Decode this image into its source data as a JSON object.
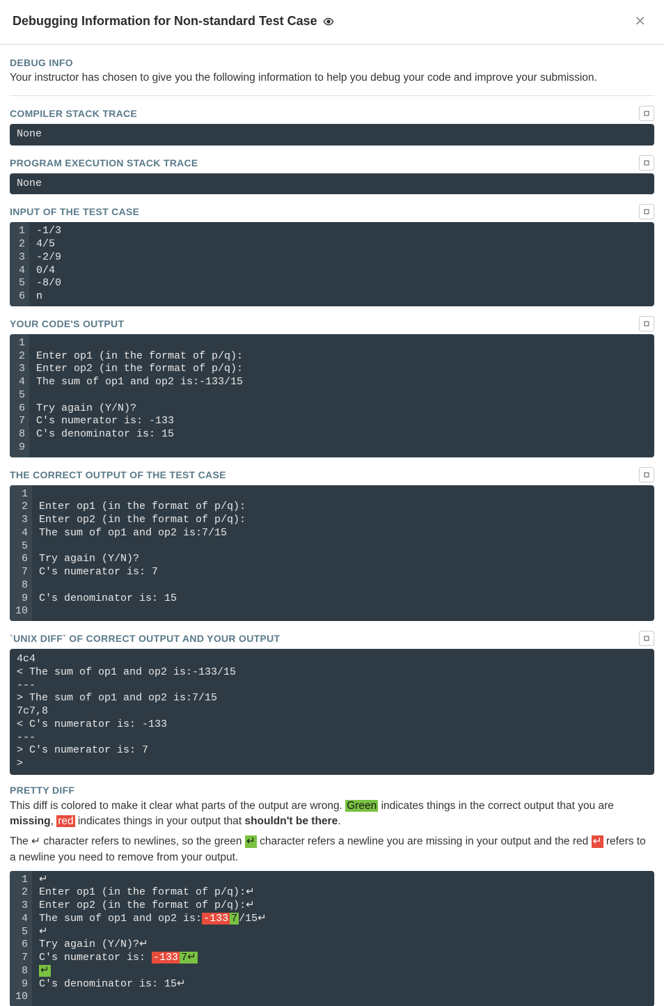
{
  "header": {
    "title": "Debugging Information for Non-standard Test Case"
  },
  "debugInfo": {
    "label": "DEBUG INFO",
    "desc": "Your instructor has chosen to give you the following information to help you debug your code and improve your submission."
  },
  "compilerTrace": {
    "label": "COMPILER STACK TRACE",
    "content": "None"
  },
  "execTrace": {
    "label": "PROGRAM EXECUTION STACK TRACE",
    "content": "None"
  },
  "inputCase": {
    "label": "INPUT OF THE TEST CASE",
    "lines": [
      "-1/3",
      "4/5",
      "-2/9",
      "0/4",
      "-8/0",
      "n"
    ]
  },
  "yourOutput": {
    "label": "YOUR CODE'S OUTPUT",
    "lines": [
      "",
      "Enter op1 (in the format of p/q):",
      "Enter op2 (in the format of p/q):",
      "The sum of op1 and op2 is:-133/15",
      "",
      "Try again (Y/N)?",
      "C's numerator is: -133",
      "C's denominator is: 15",
      ""
    ]
  },
  "correctOutput": {
    "label": "THE CORRECT OUTPUT OF THE TEST CASE",
    "lines": [
      "",
      "Enter op1 (in the format of p/q):",
      "Enter op2 (in the format of p/q):",
      "The sum of op1 and op2 is:7/15",
      "",
      "Try again (Y/N)?",
      "C's numerator is: 7",
      "",
      "C's denominator is: 15",
      ""
    ]
  },
  "unixDiff": {
    "label": "`UNIX DIFF` OF CORRECT OUTPUT AND YOUR OUTPUT",
    "content": "4c4\n< The sum of op1 and op2 is:-133/15\n---\n> The sum of op1 and op2 is:7/15\n7c7,8\n< C's numerator is: -133\n---\n> C's numerator is: 7\n>"
  },
  "prettyDiff": {
    "label": "PRETTY DIFF",
    "desc1_a": "This diff is colored to make it clear what parts of the output are wrong. ",
    "desc1_green": "Green",
    "desc1_b": " indicates things in the correct output that you are ",
    "desc1_missing": "missing",
    "desc1_c": ", ",
    "desc1_red": "red",
    "desc1_d": " indicates things in your output that ",
    "desc1_shouldnt": "shouldn't be there",
    "desc1_e": ".",
    "desc2_a": "The ",
    "desc2_nl1": "↵",
    "desc2_b": " character refers to newlines, so the green ",
    "desc2_nl2": "↵",
    "desc2_c": " character refers a newline you are missing in your output and the red ",
    "desc2_nl3": "↵",
    "desc2_d": " refers to a newline you need to remove from your output.",
    "lines": [
      [
        {
          "t": "↵",
          "c": ""
        }
      ],
      [
        {
          "t": "Enter op1 (in the format of p/q):↵",
          "c": ""
        }
      ],
      [
        {
          "t": "Enter op2 (in the format of p/q):↵",
          "c": ""
        }
      ],
      [
        {
          "t": "The sum of op1 and op2 is:",
          "c": ""
        },
        {
          "t": "-133",
          "c": "red"
        },
        {
          "t": "7",
          "c": "green"
        },
        {
          "t": "/15↵",
          "c": ""
        }
      ],
      [
        {
          "t": "↵",
          "c": ""
        }
      ],
      [
        {
          "t": "Try again (Y/N)?↵",
          "c": ""
        }
      ],
      [
        {
          "t": "C's numerator is: ",
          "c": ""
        },
        {
          "t": "-133",
          "c": "red"
        },
        {
          "t": "7↵",
          "c": "green"
        }
      ],
      [
        {
          "t": "↵",
          "c": "green"
        }
      ],
      [
        {
          "t": "C's denominator is: 15↵",
          "c": ""
        }
      ],
      [
        {
          "t": "",
          "c": ""
        }
      ]
    ]
  }
}
